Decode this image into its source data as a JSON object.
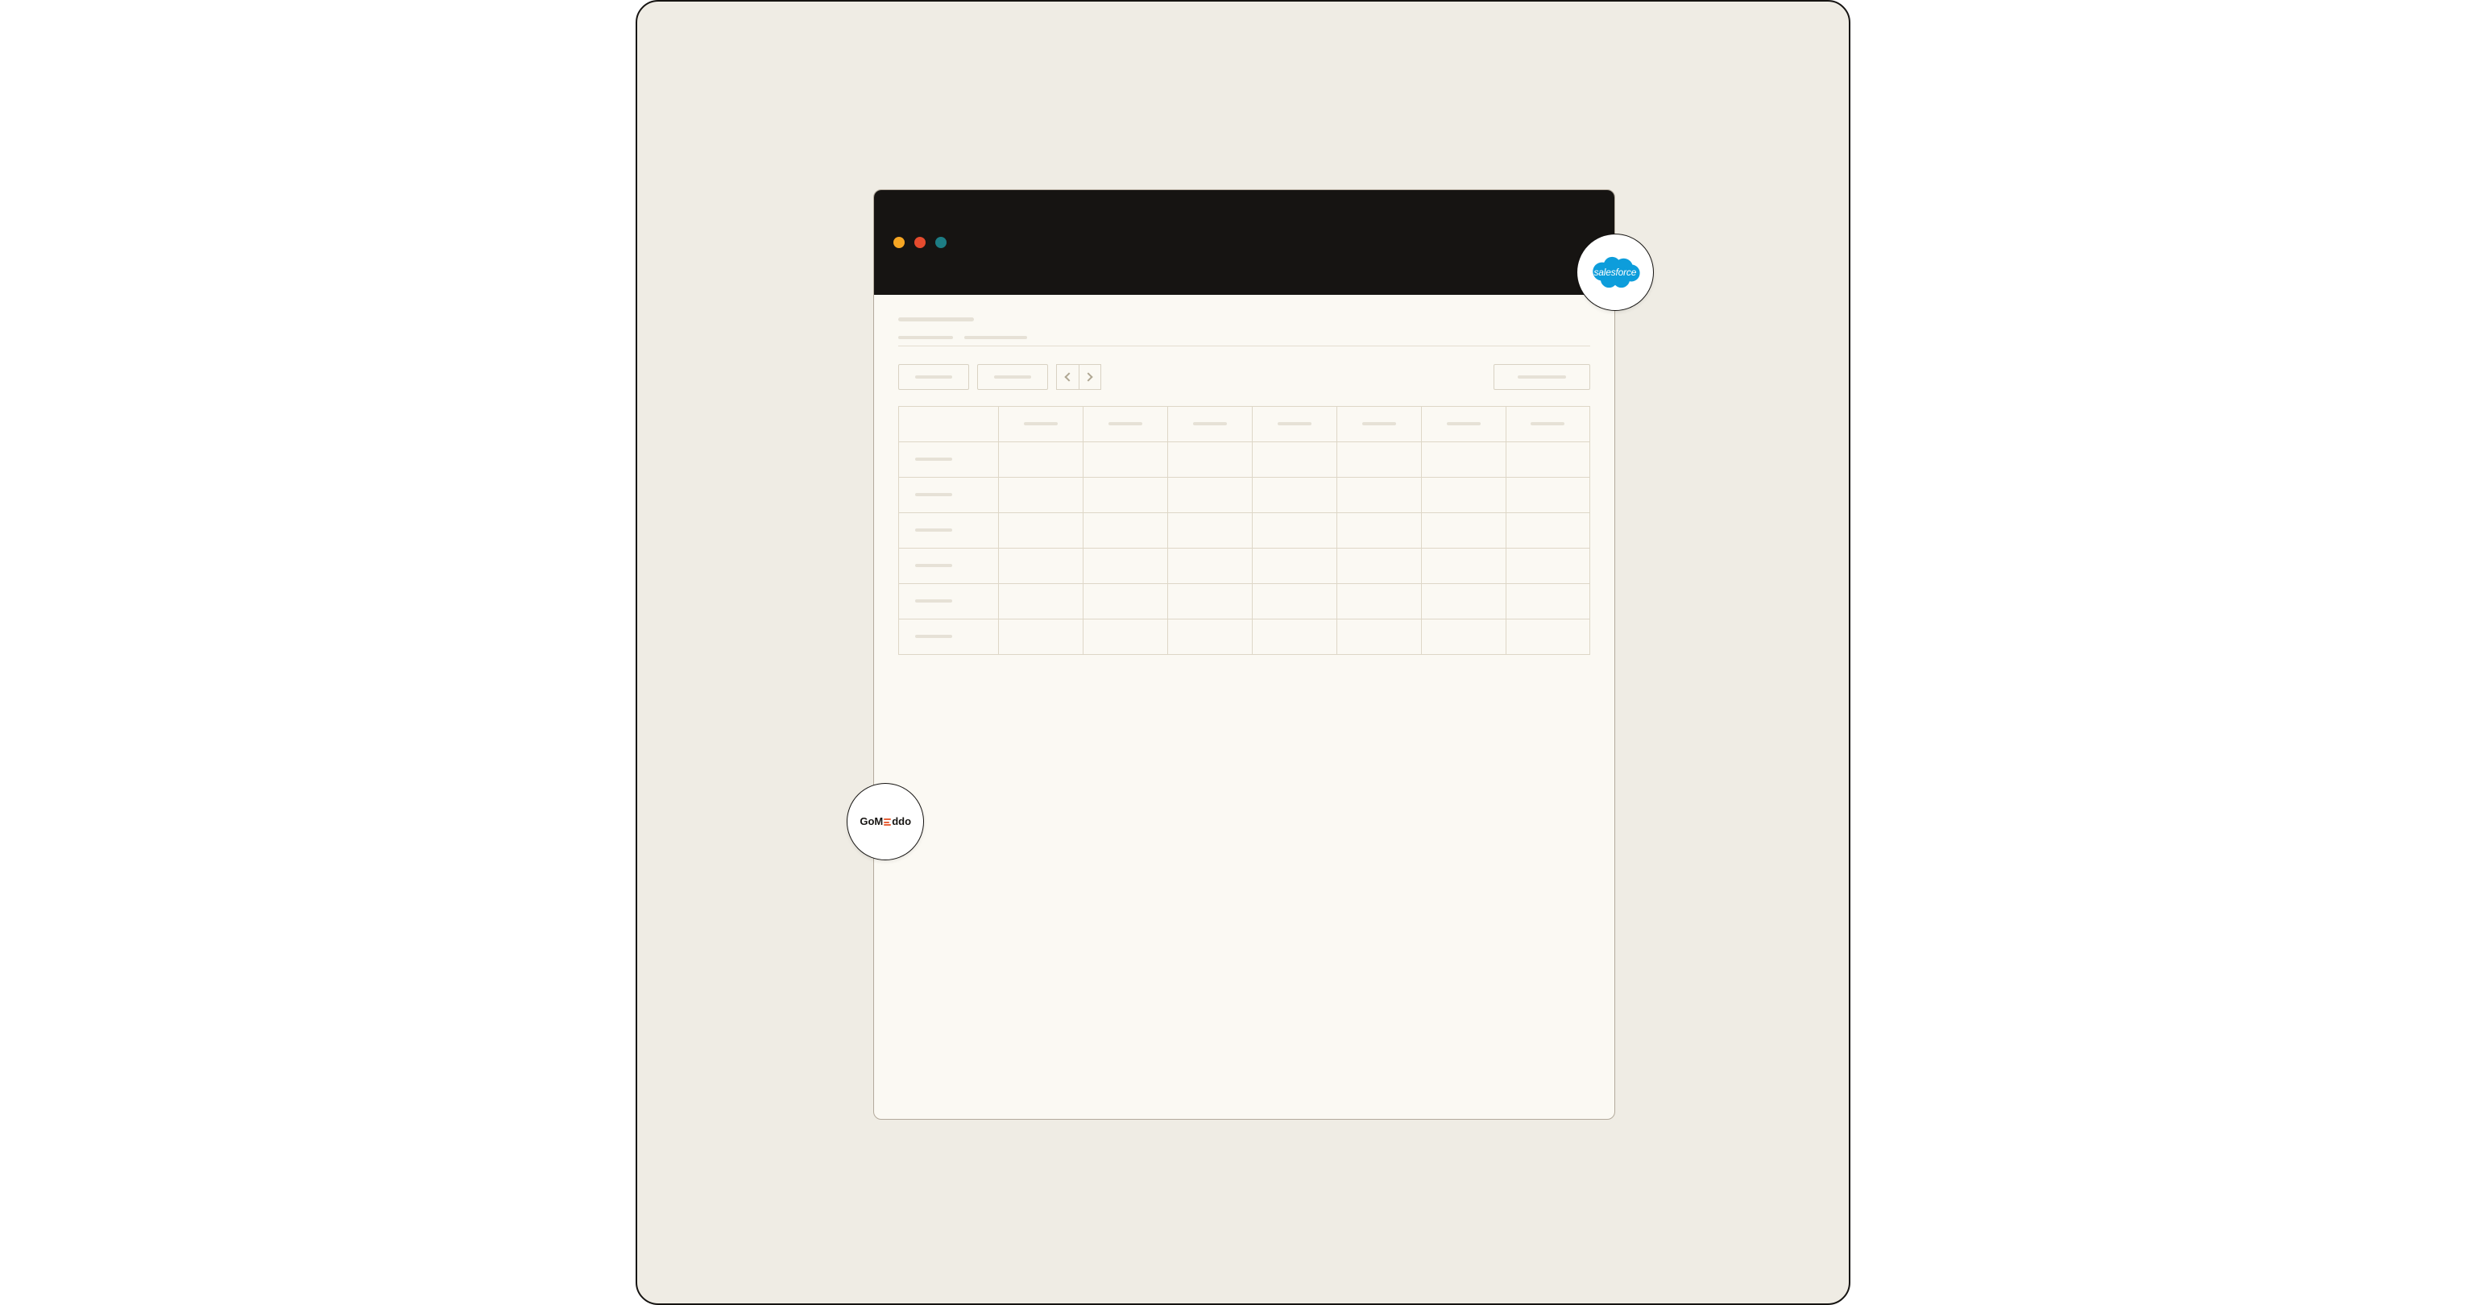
{
  "badges": {
    "salesforce_label": "salesforce",
    "gomeddo_prefix": "GoM",
    "gomeddo_suffix": "ddo"
  },
  "window": {
    "traffic": {
      "close": "close",
      "min": "minimize",
      "max": "maximize"
    }
  },
  "toolbar": {
    "btn1": "",
    "btn2": "",
    "prev": "‹",
    "next": "›",
    "right": ""
  },
  "grid": {
    "columns": [
      "",
      "",
      "",
      "",
      "",
      "",
      "",
      ""
    ],
    "rows": [
      {
        "label": "",
        "cells": [
          "",
          "",
          "",
          "",
          "",
          "",
          ""
        ]
      },
      {
        "label": "",
        "cells": [
          "",
          "",
          "",
          "",
          "",
          "",
          ""
        ]
      },
      {
        "label": "",
        "cells": [
          "",
          "",
          "",
          "",
          "",
          "",
          ""
        ]
      },
      {
        "label": "",
        "cells": [
          "",
          "",
          "",
          "",
          "",
          "",
          ""
        ]
      },
      {
        "label": "",
        "cells": [
          "",
          "",
          "",
          "",
          "",
          "",
          ""
        ]
      },
      {
        "label": "",
        "cells": [
          "",
          "",
          "",
          "",
          "",
          "",
          ""
        ]
      }
    ]
  }
}
